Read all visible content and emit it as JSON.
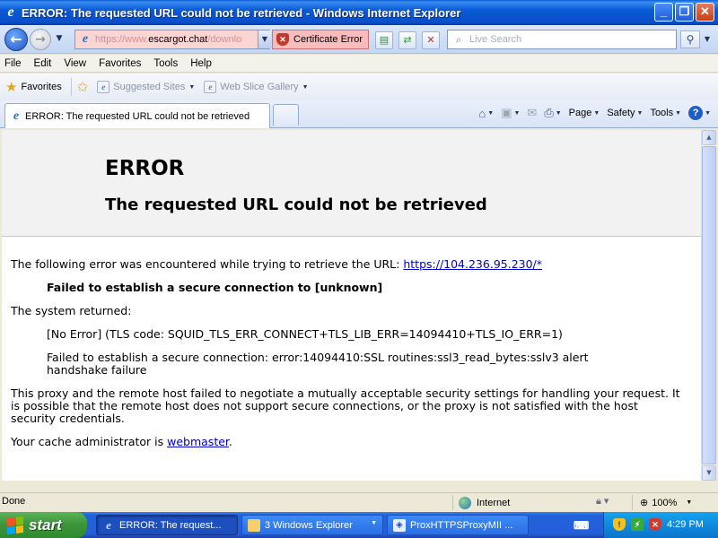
{
  "window": {
    "title": "ERROR: The requested URL could not be retrieved - Windows Internet Explorer",
    "minimize": "_",
    "restore": "❐",
    "close": "✕"
  },
  "address_bar": {
    "url_prefix": "https://www.",
    "url_domain": "escargot.chat",
    "url_suffix": "/downlo",
    "certificate_error": "Certificate Error",
    "search_placeholder": "Live Search"
  },
  "menu": [
    "File",
    "Edit",
    "View",
    "Favorites",
    "Tools",
    "Help"
  ],
  "favorites_bar": {
    "favorites": "Favorites",
    "suggested_sites": "Suggested Sites",
    "web_slice_gallery": "Web Slice Gallery"
  },
  "tab": {
    "title": "ERROR: The requested URL could not be retrieved"
  },
  "command_bar": {
    "page": "Page",
    "safety": "Safety",
    "tools": "Tools",
    "help": "?"
  },
  "page": {
    "h1": "ERROR",
    "h2": "The requested URL could not be retrieved",
    "intro_text": "The following error was encountered while trying to retrieve the URL: ",
    "intro_link": "https://104.236.95.230/*",
    "failed_title": "Failed to establish a secure connection to [unknown]",
    "system_returned": "The system returned:",
    "tls_code": "[No Error] (TLS code: SQUID_TLS_ERR_CONNECT+TLS_LIB_ERR=14094410+TLS_IO_ERR=1)",
    "handshake_line1": "Failed to establish a secure connection: error:14094410:SSL routines:ssl3_read_bytes:sslv3 alert",
    "handshake_line2": "handshake failure",
    "proxy_line1": "This proxy and the remote host failed to negotiate a mutually acceptable security settings for handling your request. It",
    "proxy_line2": "is possible that the remote host does not support secure connections, or the proxy is not satisfied with the host",
    "proxy_line3": "security credentials.",
    "admin_text": "Your cache administrator is ",
    "admin_link": "webmaster",
    "admin_end": "."
  },
  "status_bar": {
    "status": "Done",
    "zone": "Internet",
    "zoom": "100%"
  },
  "taskbar": {
    "start": "start",
    "buttons": [
      {
        "label": "ERROR: The request...",
        "active": true
      },
      {
        "label": "3 Windows Explorer",
        "active": false
      },
      {
        "label": "ProxHTTPSProxyMII ...",
        "active": false
      }
    ],
    "clock": "4:29 PM"
  },
  "colors": {
    "title_bar": "#0a4fc9",
    "cert_error_bg": "#f8bcbc",
    "link": "#0000cc",
    "start_button": "#3c943a"
  }
}
